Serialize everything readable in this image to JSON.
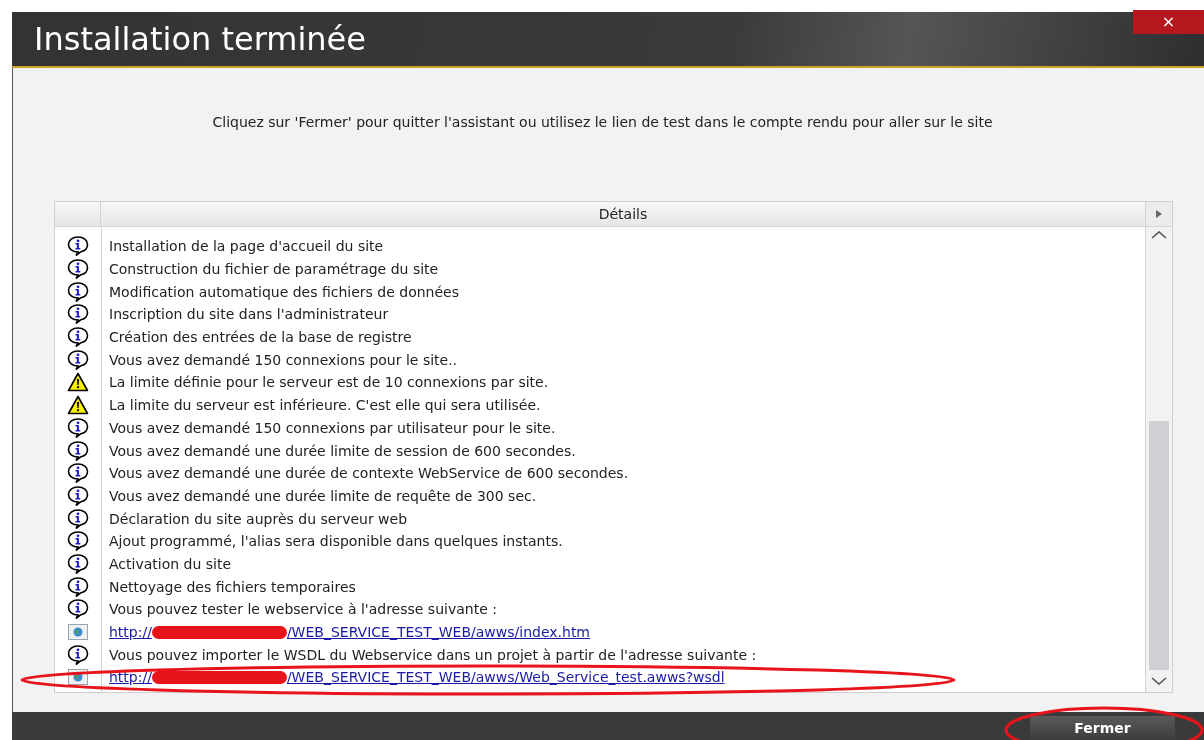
{
  "window": {
    "title": "Installation terminée",
    "close_label": "×"
  },
  "instruction": "Cliquez sur 'Fermer' pour quitter l'assistant ou utilisez le lien de test dans le compte rendu pour aller sur le site",
  "details": {
    "column_title": "Détails",
    "rows": [
      {
        "kind": "info",
        "text": "Installation de la page d'accueil du site"
      },
      {
        "kind": "info",
        "text": "Construction du fichier de paramétrage du site"
      },
      {
        "kind": "info",
        "text": "Modification automatique des fichiers de données"
      },
      {
        "kind": "info",
        "text": "Inscription du site dans l'administrateur"
      },
      {
        "kind": "info",
        "text": "Création des entrées de la base de registre"
      },
      {
        "kind": "info",
        "text": "Vous avez demandé 150 connexions pour le site.."
      },
      {
        "kind": "warning",
        "text": "La limite définie pour le serveur est de 10 connexions par site."
      },
      {
        "kind": "warning",
        "text": "La limite du serveur est inférieure. C'est elle qui sera utilisée."
      },
      {
        "kind": "info",
        "text": "Vous avez demandé 150 connexions par utilisateur pour le site."
      },
      {
        "kind": "info",
        "text": "Vous avez demandé une durée limite de session de 600 secondes."
      },
      {
        "kind": "info",
        "text": "Vous avez demandé une durée de contexte WebService de 600 secondes."
      },
      {
        "kind": "info",
        "text": "Vous avez demandé une durée limite de requête de 300 sec."
      },
      {
        "kind": "info",
        "text": "Déclaration du site auprès du serveur web"
      },
      {
        "kind": "info",
        "text": "Ajout programmé, l'alias sera disponible dans quelques instants."
      },
      {
        "kind": "info",
        "text": "Activation du site"
      },
      {
        "kind": "info",
        "text": "Nettoyage des fichiers temporaires"
      },
      {
        "kind": "info",
        "text": "Vous pouvez tester le webservice à l'adresse suivante :"
      },
      {
        "kind": "link",
        "prefix": "http://",
        "text": "/WEB_SERVICE_TEST_WEB/awws/index.htm"
      },
      {
        "kind": "info",
        "text": "Vous pouvez importer le WSDL du Webservice dans un projet à partir de l'adresse suivante :"
      },
      {
        "kind": "link",
        "prefix": "http://",
        "text": "/WEB_SERVICE_TEST_WEB/awws/Web_Service_test.awws?wsdl"
      }
    ]
  },
  "buttons": [
    {
      "label": "Fermer"
    }
  ]
}
